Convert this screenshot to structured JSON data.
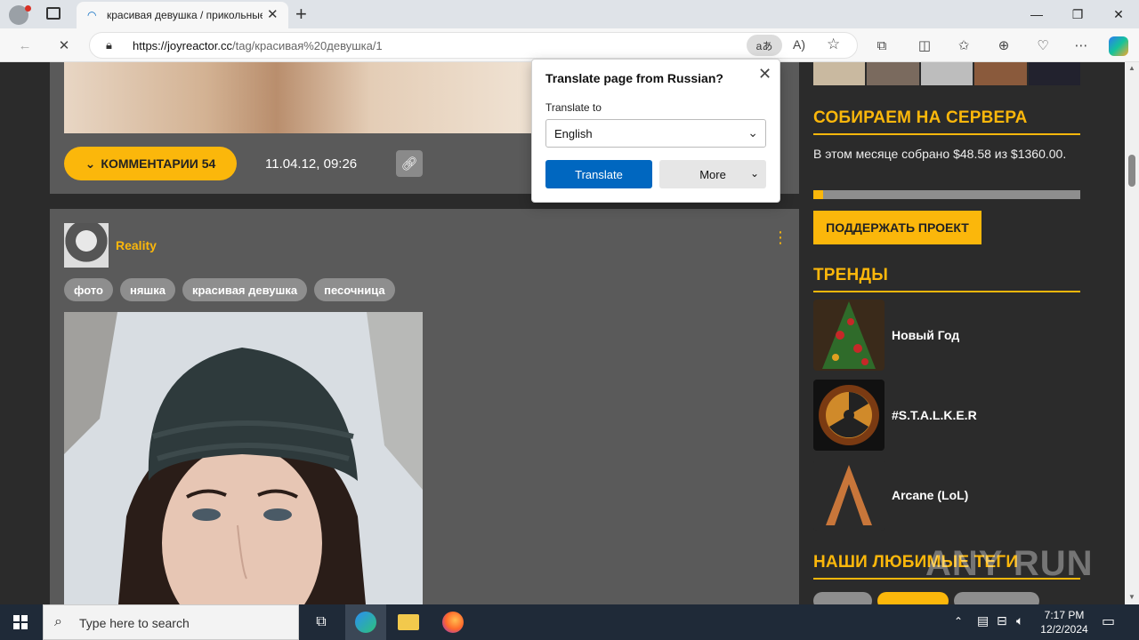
{
  "browser": {
    "tab_title": "красивая девушка / прикольные",
    "url_host": "https://joyreactor.cc",
    "url_path": "/tag/красивая%20девушка/1"
  },
  "post1": {
    "comments_label": "КОММЕНТАРИИ 54",
    "date": "11.04.12, 09:26"
  },
  "post2": {
    "author": "Reality",
    "tags": [
      "фото",
      "няшка",
      "красивая девушка",
      "песочница"
    ]
  },
  "sidebar": {
    "donate_title": "СОБИРАЕМ НА СЕРВЕРА",
    "donate_text": "В этом месяце собрано $48.58 из $1360.00.",
    "donate_progress": 0.036,
    "support_label": "ПОДДЕРЖАТЬ ПРОЕКТ",
    "trends_title": "ТРЕНДЫ",
    "trends": [
      {
        "label": "Новый Год"
      },
      {
        "label": "#S.T.A.L.K.E.R"
      },
      {
        "label": "Arcane (LoL)"
      }
    ],
    "fav_tags_title": "НАШИ ЛЮБИМЫЕ ТЕГИ"
  },
  "translate_popup": {
    "title": "Translate page from Russian?",
    "to_label": "Translate to",
    "language": "English",
    "translate_btn": "Translate",
    "more_btn": "More"
  },
  "watermark": "ANY RUN",
  "taskbar": {
    "search_placeholder": "Type here to search",
    "time": "7:17 PM",
    "date": "12/2/2024"
  },
  "colors": {
    "accent": "#fbb70b",
    "edge_blue": "#0067c0"
  }
}
